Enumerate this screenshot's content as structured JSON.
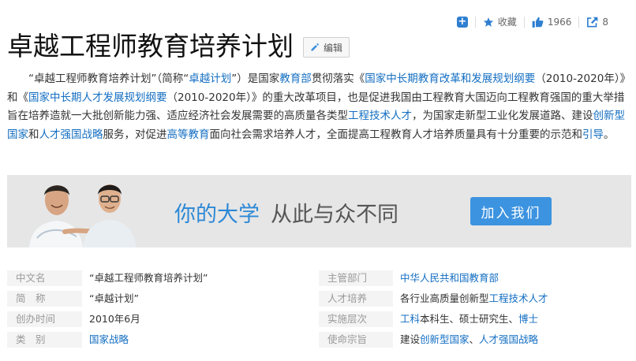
{
  "actions": {
    "favorite_label": "收藏",
    "like_count": "1966",
    "share_count": "8"
  },
  "title": "卓越工程师教育培养计划",
  "edit_label": "编辑",
  "summary": [
    {
      "t": "“卓越工程师教育培养计划”（简称“"
    },
    {
      "t": "卓越计划",
      "link": true
    },
    {
      "t": "”）是国家"
    },
    {
      "t": "教育部",
      "link": true
    },
    {
      "t": "贯彻落实《"
    },
    {
      "t": "国家中长期教育改革和发展规划纲要",
      "link": true
    },
    {
      "t": "（2010-2020年）》和《"
    },
    {
      "t": "国家中长期人才发展规划纲要",
      "link": true
    },
    {
      "t": "（2010-2020年）》的重大改革项目，也是促进我国由工程教育大国迈向工程教育强国的重大举措旨在培养造就一大批创新能力强、适应经济社会发展需要的高质量各类型"
    },
    {
      "t": "工程技术人才",
      "link": true
    },
    {
      "t": "，为国家走新型工业化发展道路、建设"
    },
    {
      "t": "创新型国家",
      "link": true
    },
    {
      "t": "和"
    },
    {
      "t": "人才强国战略",
      "link": true
    },
    {
      "t": "服务，对促进"
    },
    {
      "t": "高等教育",
      "link": true
    },
    {
      "t": "面向社会需求培养人才，全面提高工程教育人才培养质量具有十分重要的示范和"
    },
    {
      "t": "引导",
      "link": true
    },
    {
      "t": "。"
    }
  ],
  "banner": {
    "headline_a": "你的大学",
    "headline_b": "从此与众不同",
    "button": "加入我们"
  },
  "info": [
    {
      "left": {
        "key": "中文名",
        "val": [
          {
            "t": "“卓越工程师教育培养计划”"
          }
        ]
      },
      "right": {
        "key": "主管部门",
        "val": [
          {
            "t": "中华人民共和国教育部",
            "link": true
          }
        ]
      }
    },
    {
      "left": {
        "key": "简　称",
        "val": [
          {
            "t": "“卓越计划”"
          }
        ]
      },
      "right": {
        "key": "人才培养",
        "val": [
          {
            "t": "各行业高质量创新型"
          },
          {
            "t": "工程技术人才",
            "link": true
          }
        ]
      }
    },
    {
      "left": {
        "key": "创办时间",
        "val": [
          {
            "t": "2010年6月"
          }
        ]
      },
      "right": {
        "key": "实施层次",
        "val": [
          {
            "t": "工科",
            "link": true
          },
          {
            "t": "本科生、硕士研究生、"
          },
          {
            "t": "博士",
            "link": true
          }
        ]
      }
    },
    {
      "left": {
        "key": "类　别",
        "val": [
          {
            "t": "国家战略",
            "link": true
          }
        ]
      },
      "right": {
        "key": "使命宗旨",
        "val": [
          {
            "t": "建设"
          },
          {
            "t": "创新型国家",
            "link": true
          },
          {
            "t": "、"
          },
          {
            "t": "人才强国战略",
            "link": true
          }
        ]
      }
    }
  ]
}
